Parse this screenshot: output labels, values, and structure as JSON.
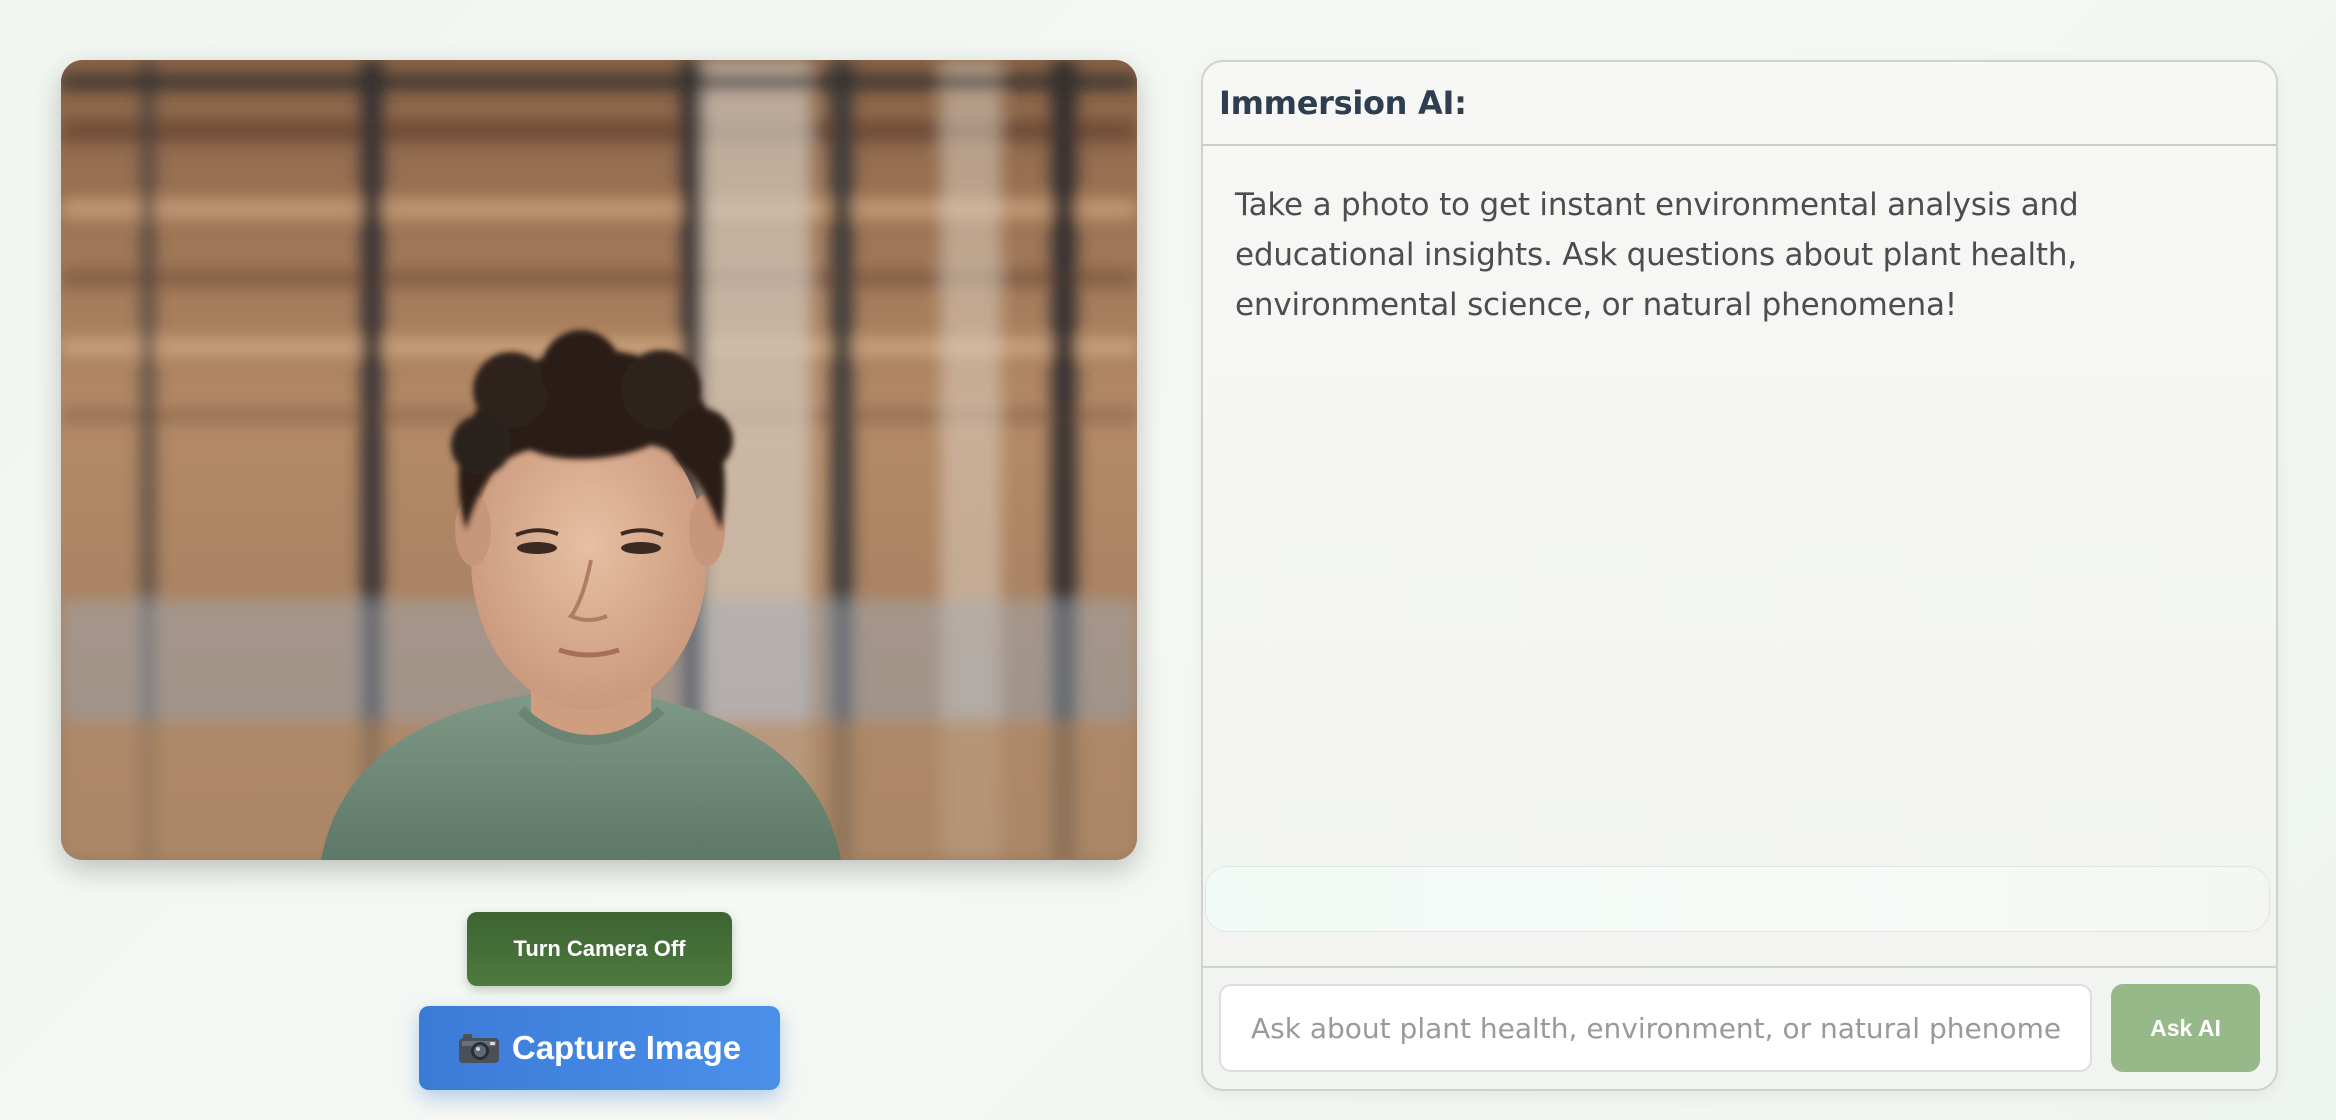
{
  "camera": {
    "toggle_label": "Turn Camera Off",
    "capture_label": "Capture Image",
    "capture_icon": "camera-icon"
  },
  "chat": {
    "title": "Immersion AI:",
    "message": "Take a photo to get instant environmental analysis and educational insights. Ask questions about plant health, environmental science, or natural phenomena!",
    "status": "",
    "input_placeholder": "Ask about plant health, environment, or natural phenomena...",
    "input_value": "",
    "ask_label": "Ask AI"
  },
  "colors": {
    "toggle_button": "#426c36",
    "capture_button": "#3f83de",
    "ask_button": "#97b98a",
    "title_text": "#2c3e50"
  }
}
